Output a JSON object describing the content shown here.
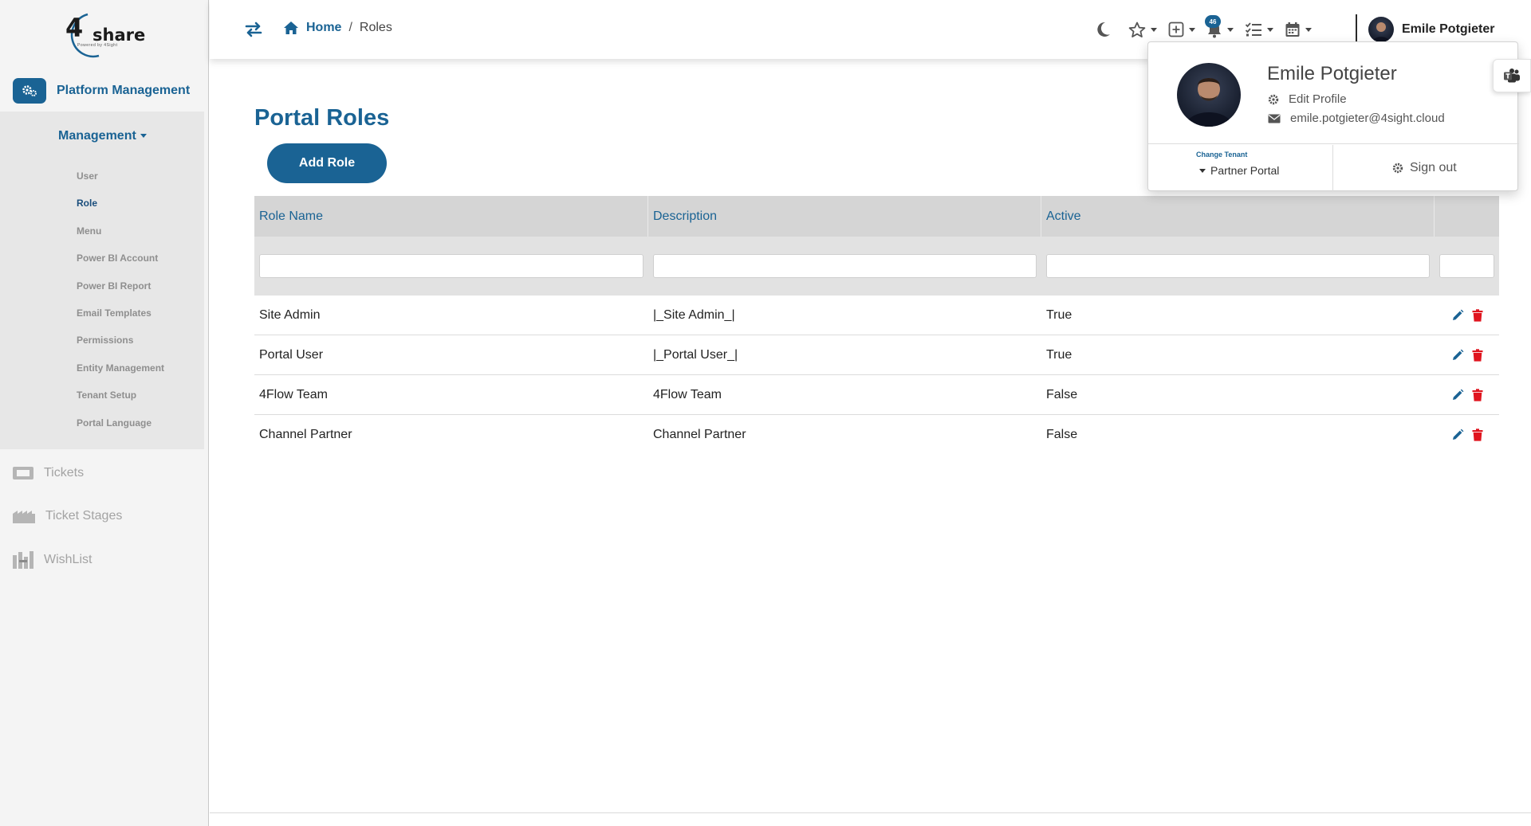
{
  "brand": {
    "logo_text": "share",
    "logo_tagline": "Powered by 4Sight"
  },
  "sidebar": {
    "platform_label": "Platform Management",
    "management_label": "Management",
    "management_items": [
      {
        "label": "User"
      },
      {
        "label": "Role"
      },
      {
        "label": "Menu"
      },
      {
        "label": "Power BI Account"
      },
      {
        "label": "Power BI Report"
      },
      {
        "label": "Email Templates"
      },
      {
        "label": "Permissions"
      },
      {
        "label": "Entity Management"
      },
      {
        "label": "Tenant Setup"
      },
      {
        "label": "Portal Language"
      }
    ],
    "active_item": "Role",
    "links": [
      {
        "label": "Tickets",
        "icon": "ticket-icon"
      },
      {
        "label": "Ticket Stages",
        "icon": "industry-icon"
      },
      {
        "label": "WishList",
        "icon": "wishlist-icon"
      }
    ]
  },
  "topbar": {
    "breadcrumb": {
      "home": "Home",
      "separator": "/",
      "current": "Roles"
    },
    "notification_count": "46",
    "user_name": "Emile Potgieter"
  },
  "main": {
    "title": "Portal Roles",
    "add_button": "Add Role",
    "columns": [
      "Role Name",
      "Description",
      "Active",
      ""
    ],
    "rows": [
      {
        "name": "Site Admin",
        "description": "|_Site Admin_|",
        "active": "True"
      },
      {
        "name": "Portal User",
        "description": "|_Portal User_|",
        "active": "True"
      },
      {
        "name": "4Flow Team",
        "description": "4Flow Team",
        "active": "False"
      },
      {
        "name": "Channel Partner",
        "description": "Channel Partner",
        "active": "False"
      }
    ]
  },
  "profile_menu": {
    "name": "Emile Potgieter",
    "edit_profile": "Edit Profile",
    "email": "emile.potgieter@4sight.cloud",
    "change_tenant_label": "Change Tenant",
    "tenant": "Partner Portal",
    "sign_out": "Sign out"
  },
  "colors": {
    "primary": "#1a6394",
    "danger": "#e0141e",
    "sidebar_bg": "#f4f4f4",
    "submenu_bg": "#e7e7e7"
  }
}
